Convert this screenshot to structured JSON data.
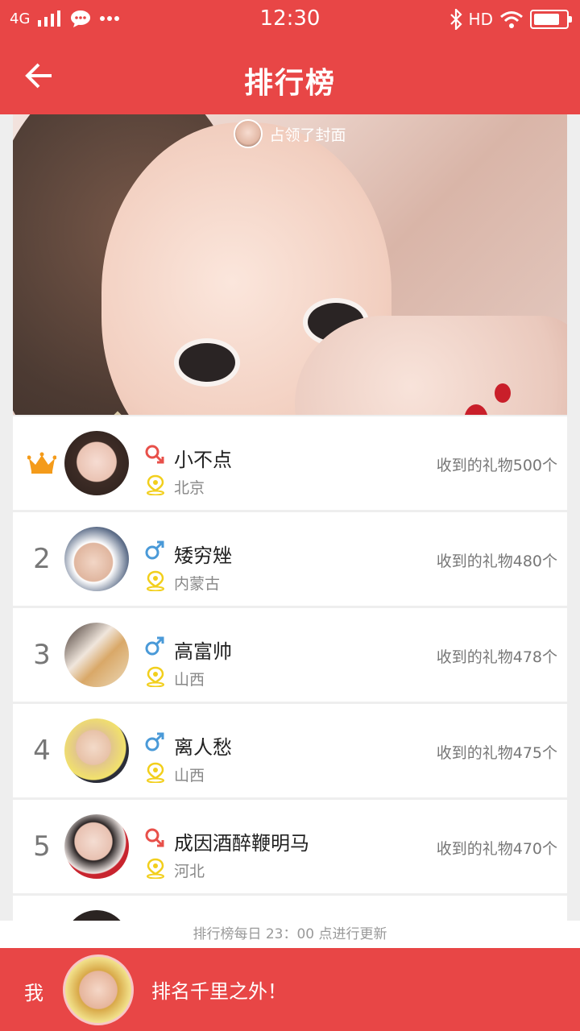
{
  "status_bar": {
    "network": "4G",
    "time": "12:30",
    "hd": "HD",
    "battery_level": 0.9,
    "icons": [
      "signal-icon",
      "chat-icon",
      "more-icon",
      "bluetooth-icon",
      "wifi-icon",
      "battery-icon"
    ]
  },
  "header": {
    "title": "排行榜",
    "back_icon": "arrow-left-icon"
  },
  "cover": {
    "tag_text": "占领了封面"
  },
  "rankings": [
    {
      "rank": "",
      "crown": true,
      "gender": "female",
      "name": "小不点",
      "city": "北京",
      "gifts": "收到的礼物500个"
    },
    {
      "rank": "2",
      "crown": false,
      "gender": "male",
      "name": "矮穷矬",
      "city": "内蒙古",
      "gifts": "收到的礼物480个"
    },
    {
      "rank": "3",
      "crown": false,
      "gender": "male",
      "name": "高富帅",
      "city": "山西",
      "gifts": "收到的礼物478个"
    },
    {
      "rank": "4",
      "crown": false,
      "gender": "male",
      "name": "离人愁",
      "city": "山西",
      "gifts": "收到的礼物475个"
    },
    {
      "rank": "5",
      "crown": false,
      "gender": "female",
      "name": "成因酒醉鞭明马",
      "city": "河北",
      "gifts": "收到的礼物470个"
    }
  ],
  "notice": "排行榜每日 23：00 点进行更新",
  "footer": {
    "me_label": "我",
    "my_rank_text": "排名千里之外！"
  },
  "colors": {
    "primary": "#e84646",
    "female": "#e8504a",
    "male": "#4a9ad8",
    "pin": "#f2cf1c",
    "crown": "#f49b1a"
  }
}
